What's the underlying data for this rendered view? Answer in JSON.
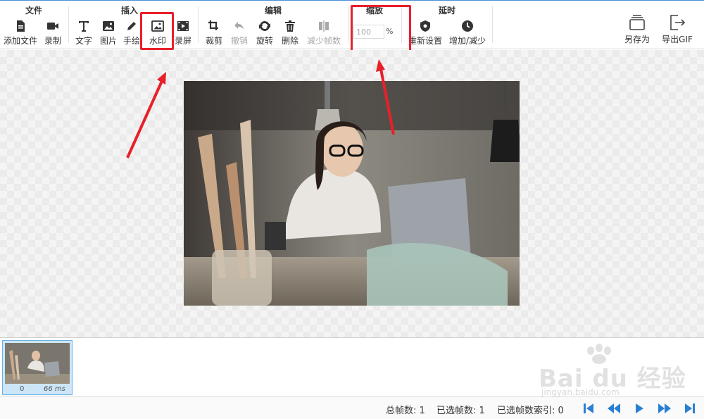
{
  "colors": {
    "accent": "#2a7fd4",
    "highlight": "#e8202a",
    "disabled": "#a8a8a8"
  },
  "groups": {
    "file": {
      "title": "文件",
      "add_file": "添加文件",
      "record": "录制"
    },
    "insert": {
      "title": "插入",
      "text": "文字",
      "image": "图片",
      "draw": "手绘",
      "watermark": "水印",
      "screen": "录屏"
    },
    "edit": {
      "title": "编辑",
      "crop": "裁剪",
      "undo": "撤销",
      "rotate": "旋转",
      "delete": "删除",
      "reduce": "减少帧数"
    },
    "zoom": {
      "title": "缩放",
      "value": "100",
      "unit": "%"
    },
    "delay": {
      "title": "延时",
      "reset": "重新设置",
      "adjust": "增加/减少"
    },
    "right": {
      "save_as": "另存为",
      "export": "导出GIF"
    }
  },
  "filmstrip": {
    "frames": [
      {
        "index": "0",
        "duration": "66 ms"
      }
    ]
  },
  "status": {
    "total_label": "总帧数: 1",
    "selected_label": "已选帧数: 1",
    "index_label": "已选帧数索引: 0"
  },
  "watermark": {
    "brand": "Bai du 经验",
    "url": "jingyan.baidu.com"
  }
}
